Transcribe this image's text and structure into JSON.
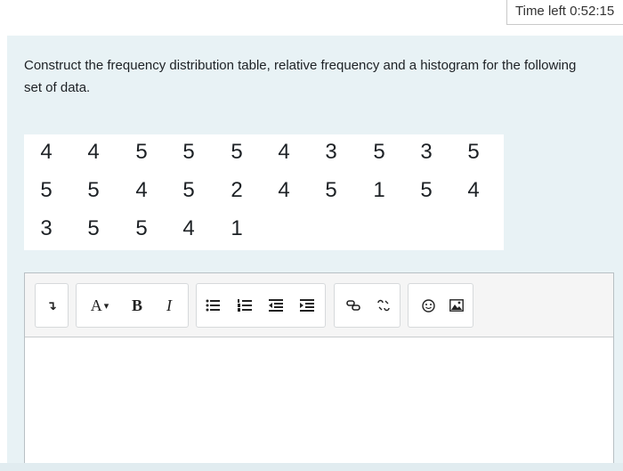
{
  "timer": {
    "label": "Time left 0:52:15"
  },
  "question": {
    "text": "Construct the frequency distribution table, relative frequency and a histogram for the following set of data."
  },
  "data_rows": [
    [
      "4",
      "4",
      "5",
      "5",
      "5",
      "4",
      "3",
      "5",
      "3",
      "5"
    ],
    [
      "5",
      "5",
      "4",
      "5",
      "2",
      "4",
      "5",
      "1",
      "5",
      "4"
    ],
    [
      "3",
      "5",
      "5",
      "4",
      "1"
    ]
  ],
  "editor": {
    "toolbar": {
      "collapse": "↴",
      "paragraph": "A",
      "paragraph_arrow": "▾",
      "bold": "B",
      "italic": "I",
      "unordered_list": "☰",
      "ordered_list": "☷",
      "outdent": "⇤",
      "indent": "⇥",
      "link": "🔗",
      "unlink": "⛓",
      "emoji": "☺",
      "image": "▣"
    },
    "content": ""
  }
}
